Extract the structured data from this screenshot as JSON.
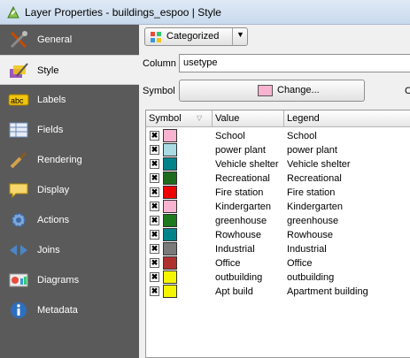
{
  "window": {
    "title": "Layer Properties - buildings_espoo | Style"
  },
  "sidebar": {
    "items": [
      {
        "label": "General"
      },
      {
        "label": "Style"
      },
      {
        "label": "Labels"
      },
      {
        "label": "Fields"
      },
      {
        "label": "Rendering"
      },
      {
        "label": "Display"
      },
      {
        "label": "Actions"
      },
      {
        "label": "Joins"
      },
      {
        "label": "Diagrams"
      },
      {
        "label": "Metadata"
      }
    ],
    "active": "Style"
  },
  "renderer": {
    "selected": "Categorized"
  },
  "column": {
    "label": "Column",
    "value": "usetype"
  },
  "symbol": {
    "label": "Symbol",
    "change_label": "Change...",
    "swatch_color": "#f7b3d0",
    "cut_label": "C"
  },
  "table": {
    "headers": {
      "symbol": "Symbol",
      "value": "Value",
      "legend": "Legend"
    },
    "rows": [
      {
        "color": "#f7b3d0",
        "value": "School",
        "legend": "School"
      },
      {
        "color": "#a9dbe5",
        "value": "power plant",
        "legend": "power plant"
      },
      {
        "color": "#00838b",
        "value": "Vehicle shelter",
        "legend": "Vehicle shelter"
      },
      {
        "color": "#1e6b1e",
        "value": "Recreational",
        "legend": "Recreational"
      },
      {
        "color": "#ee0000",
        "value": "Fire station",
        "legend": "Fire station"
      },
      {
        "color": "#f7b3d0",
        "value": "Kindergarten",
        "legend": "Kindergarten"
      },
      {
        "color": "#1e7a1e",
        "value": "greenhouse",
        "legend": "greenhouse"
      },
      {
        "color": "#00838b",
        "value": "Rowhouse",
        "legend": "Rowhouse"
      },
      {
        "color": "#7a7a7a",
        "value": "Industrial",
        "legend": "Industrial"
      },
      {
        "color": "#b03030",
        "value": "Office",
        "legend": "Office"
      },
      {
        "color": "#f5f500",
        "value": "outbuilding",
        "legend": "outbuilding"
      },
      {
        "color": "#f5f500",
        "value": "Apt build",
        "legend": "Apartment building"
      }
    ]
  }
}
